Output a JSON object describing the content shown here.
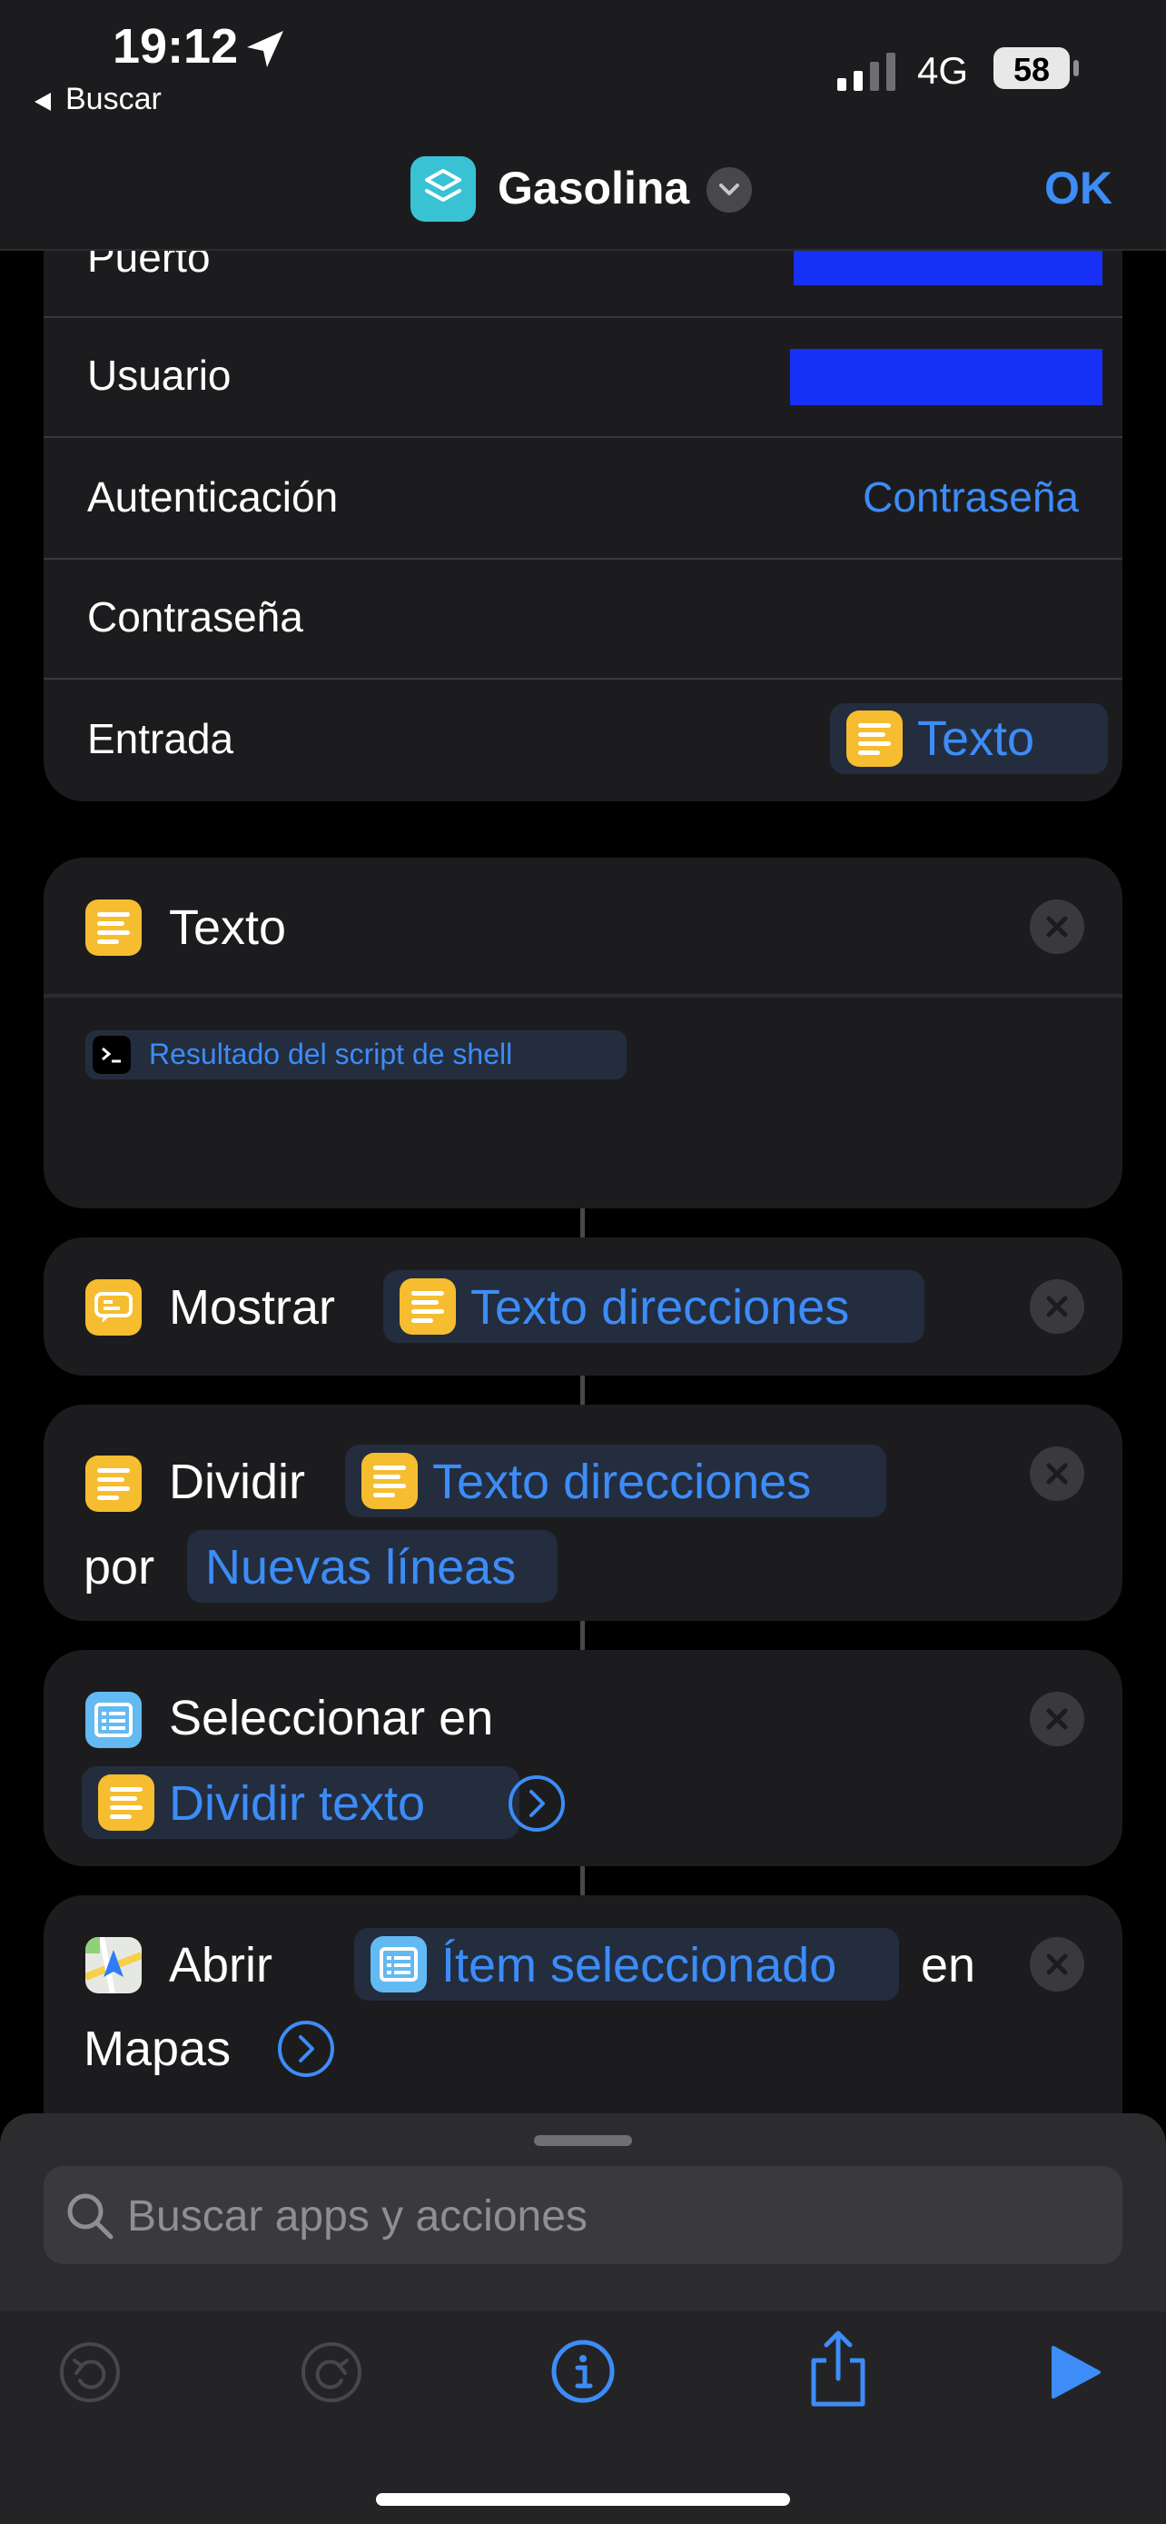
{
  "status_bar": {
    "time": "19:12",
    "back_label": "Buscar",
    "network": "4G",
    "battery": "58"
  },
  "nav": {
    "title": "Gasolina",
    "done_label": "OK"
  },
  "ssh_params": {
    "puerto_label": "Puerto",
    "usuario_label": "Usuario",
    "autenticacion_label": "Autenticación",
    "autenticacion_value": "Contraseña",
    "contrasena_label": "Contraseña",
    "entrada_label": "Entrada",
    "entrada_value": "Texto"
  },
  "texto_card": {
    "title": "Texto",
    "token": "Resultado del script de shell"
  },
  "mostrar_card": {
    "verb": "Mostrar",
    "token": "Texto direcciones"
  },
  "dividir_card": {
    "verb": "Dividir",
    "token": "Texto direcciones",
    "por": "por",
    "separator": "Nuevas líneas"
  },
  "seleccionar_card": {
    "verb": "Seleccionar en",
    "token": "Dividir texto"
  },
  "abrir_card": {
    "verb": "Abrir",
    "token": "Ítem seleccionado",
    "en": "en",
    "app": "Mapas"
  },
  "search": {
    "placeholder": "Buscar apps y acciones"
  },
  "colors": {
    "accent": "#3d8cf7",
    "text_icon": "#f5bd2f",
    "redaction": "#1630f5",
    "card": "#1c1c1e"
  },
  "icons": [
    "location-arrow-icon",
    "signal-icon",
    "battery-icon",
    "shortcut-icon",
    "chevron-down-icon",
    "text-icon",
    "terminal-icon",
    "show-result-icon",
    "list-icon",
    "maps-icon",
    "close-icon",
    "chevron-right-circle-icon",
    "search-icon",
    "undo-icon",
    "redo-icon",
    "info-icon",
    "share-icon",
    "play-icon"
  ]
}
